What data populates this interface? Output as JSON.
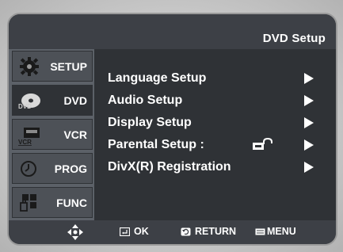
{
  "header": {
    "title": "DVD  Setup"
  },
  "sidebar": {
    "items": [
      {
        "label": "SETUP",
        "icon": "gear-icon",
        "active": false
      },
      {
        "label": "DVD",
        "icon": "dvd-disc-icon",
        "active": true
      },
      {
        "label": "VCR",
        "icon": "vcr-icon",
        "active": false
      },
      {
        "label": "PROG",
        "icon": "clock-icon",
        "active": false
      },
      {
        "label": "FUNC",
        "icon": "function-grid-icon",
        "active": false
      }
    ]
  },
  "menu": {
    "items": [
      {
        "label": "Language Setup"
      },
      {
        "label": "Audio Setup"
      },
      {
        "label": "Display Setup"
      },
      {
        "label": "Parental Setup :"
      },
      {
        "label": "DivX(R) Registration"
      }
    ],
    "parental_lock_icon": "unlocked-padlock-icon"
  },
  "footer": {
    "nav_icon": "four-way-nav-icon",
    "ok_label": "OK",
    "return_label": "RETURN",
    "menu_label": "MENU"
  },
  "colors": {
    "panel_bg": "#2f3236",
    "bar_bg": "#3d4046",
    "sidebar_bg": "#5c6168",
    "text": "#ffffff"
  }
}
